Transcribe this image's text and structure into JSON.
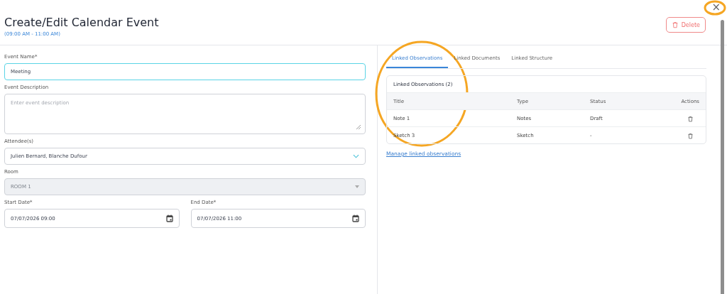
{
  "header": {
    "title": "Create/Edit Calendar Event",
    "subtitle": "(09:00 AM - 11:00 AM)",
    "delete_button": "Delete",
    "close_button": "×"
  },
  "form": {
    "fields": [
      {
        "kind": "text",
        "label": "Event Name*",
        "value": "Meeting",
        "focused": true,
        "disabled": false
      },
      {
        "kind": "textarea",
        "label": "Event Description",
        "placeholder": "Enter event description",
        "focused": false,
        "disabled": false
      },
      {
        "kind": "select",
        "label": "Attendee(s)",
        "value": "Julien Bernard, Blanche Dufour",
        "focused": false,
        "disabled": false
      },
      {
        "kind": "select",
        "label": "Room",
        "value": "ROOM 1",
        "focused": false,
        "disabled": true
      }
    ],
    "dates": [
      {
        "label": "Start Date*",
        "value": "07/07/2026 09:00"
      },
      {
        "label": "End Date*",
        "value": "07/07/2026 11:00"
      }
    ]
  },
  "tabs": [
    {
      "label": "Linked Observations",
      "selected": true
    },
    {
      "label": "Linked Documents",
      "selected": false
    },
    {
      "label": "Linked Structure",
      "selected": false
    }
  ],
  "table": {
    "title": "Linked Observations (2)",
    "columns": [
      "Title",
      "Type",
      "Status",
      "Actions"
    ],
    "rows": [
      {
        "title": "Note 1",
        "type": "Notes",
        "status": "Draft"
      },
      {
        "title": "Sketch 3",
        "type": "Sketch",
        "status": "-"
      }
    ]
  },
  "manage_link": "Manage linked observations"
}
